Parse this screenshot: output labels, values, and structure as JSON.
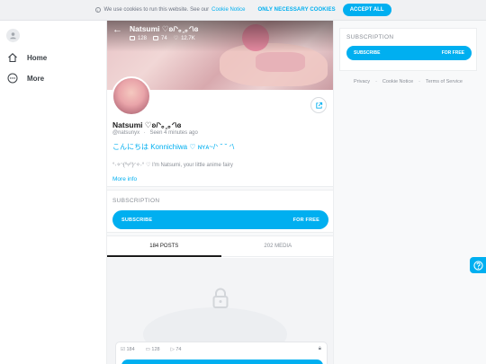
{
  "cookie": {
    "message": "We use cookies to run this website. See our",
    "policy_link": "Cookie Notice",
    "necessary_label": "ONLY NECESSARY COOKIES",
    "accept_label": "ACCEPT ALL"
  },
  "nav": {
    "items": [
      {
        "label": "Home",
        "icon": "home-icon"
      },
      {
        "label": "More",
        "icon": "more-icon"
      }
    ]
  },
  "profile": {
    "cover_name": "Natsumi ♡ʚ/ᐠ｡ꞈ｡ᐟ\\ɞ",
    "stats": {
      "photos": "128",
      "videos": "74",
      "likes": "12.7K"
    },
    "name": "Natsumi ♡ʚ/ᐠ｡ꞈ｡ᐟ\\ɞ",
    "handle": "@natsunyx",
    "seen": "Seen 4 minutes ago",
    "bio_line1": "こんにちは Konnichiwa ♡ ɴʏᴀ~/ᐠ ˘ ˘ ᐟ\\",
    "bio_line2": "°˖✧◝(⁰▿⁰)◜✧˖° ♡ I'm Natsumi, your little anime fairy",
    "more_info": "More info"
  },
  "subscription": {
    "title": "SUBSCRIPTION",
    "button_left": "SUBSCRIBE",
    "button_right": "FOR FREE"
  },
  "tabs": [
    {
      "label": "184 POSTS",
      "active": true
    },
    {
      "label": "202 MEDIA",
      "active": false
    }
  ],
  "locked_post": {
    "posts": "184",
    "photos": "128",
    "videos": "74"
  },
  "sidebar": {
    "title": "SUBSCRIPTION",
    "button_left": "SUBSCRIBE",
    "button_right": "FOR FREE",
    "footer": [
      "Privacy",
      "Cookie Notice",
      "Terms of Service"
    ]
  },
  "colors": {
    "accent": "#00aff0"
  }
}
